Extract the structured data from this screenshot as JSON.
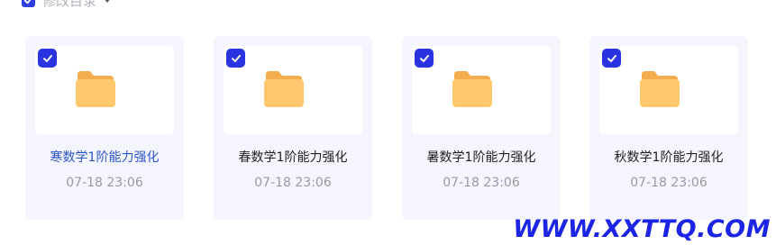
{
  "header": {
    "label": "修改目录"
  },
  "files": [
    {
      "name": "寒数学1阶能力强化",
      "date": "07-18 23:06",
      "selected": true
    },
    {
      "name": "春数学1阶能力强化",
      "date": "07-18 23:06",
      "selected": true
    },
    {
      "name": "暑数学1阶能力强化",
      "date": "07-18 23:06",
      "selected": true
    },
    {
      "name": "秋数学1阶能力强化",
      "date": "07-18 23:06",
      "selected": true
    }
  ],
  "watermark": "WWW.XXTTQ.COM",
  "colors": {
    "accent": "#2a33e0",
    "folder": "#ffc86e",
    "card_bg": "#f5f6fd",
    "link": "#2a55c9"
  }
}
